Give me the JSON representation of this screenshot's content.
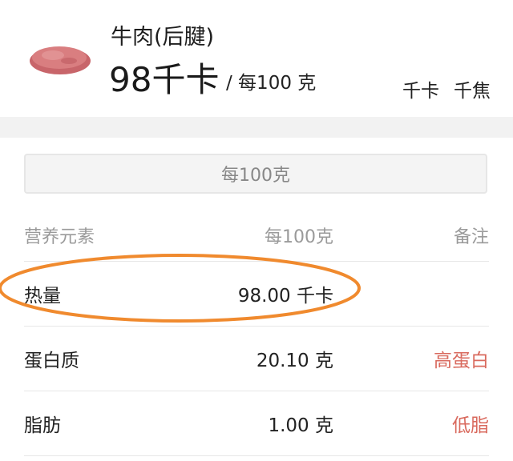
{
  "header": {
    "food_name": "牛肉(后腱)",
    "calories": "98千卡",
    "per_unit": "/ 每100 克",
    "units": [
      {
        "label": "千卡",
        "active": true
      },
      {
        "label": "千焦",
        "active": false
      }
    ]
  },
  "per_selector": {
    "label": "每100克"
  },
  "table": {
    "columns": [
      "营养元素",
      "每100克",
      "备注"
    ],
    "rows": [
      {
        "name": "热量",
        "value": "98.00 千卡",
        "note": ""
      },
      {
        "name": "蛋白质",
        "value": "20.10 克",
        "note": "高蛋白"
      },
      {
        "name": "脂肪",
        "value": "1.00 克",
        "note": "低脂"
      }
    ]
  },
  "colors": {
    "accent": "#e0766c",
    "note": "#d96a5e",
    "highlight": "#f08a2e"
  },
  "icons": {
    "food": "raw-beef-icon"
  }
}
